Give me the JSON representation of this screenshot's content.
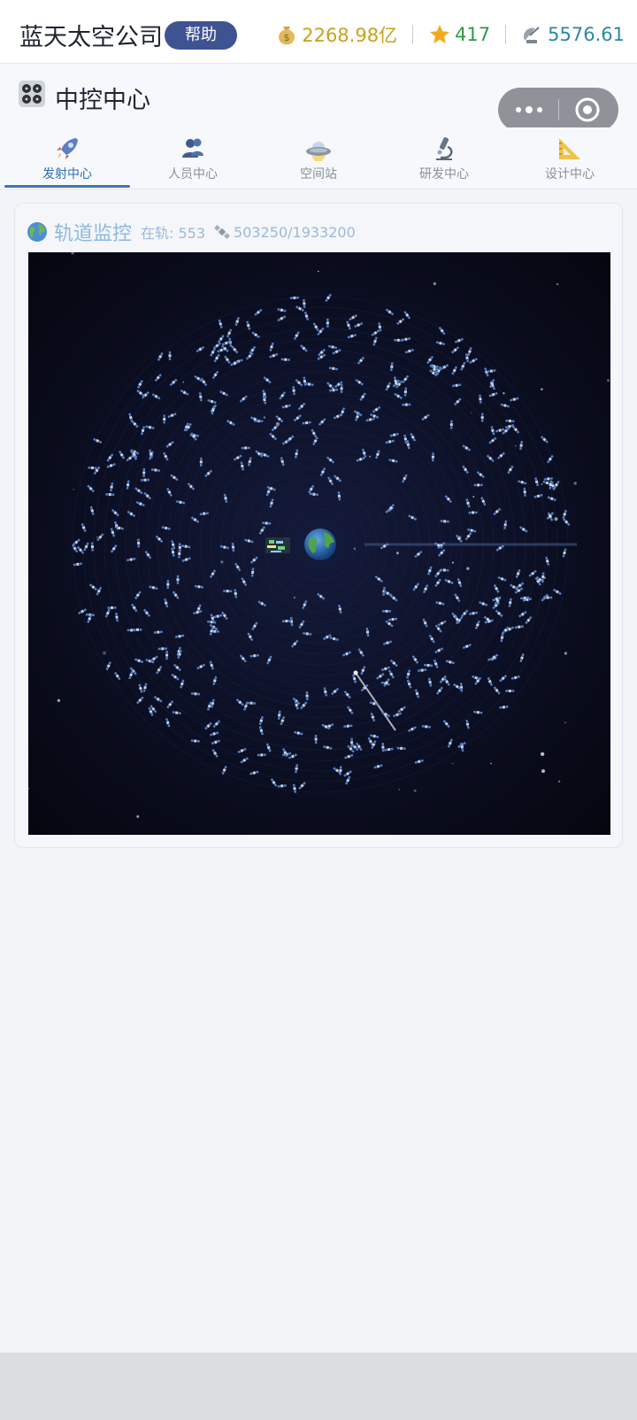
{
  "header": {
    "company_name": "蓝天太空公司",
    "help_label": "帮助",
    "stats": [
      {
        "icon": "money-bag-icon",
        "value": "2268.98亿",
        "color": "#c7a21c"
      },
      {
        "icon": "star-icon",
        "value": "417",
        "color": "#2e9a44"
      },
      {
        "icon": "satellite-dish-icon",
        "value": "5576.61",
        "color": "#2a86a8"
      }
    ]
  },
  "subhead": {
    "icon": "control-knobs-icon",
    "title": "中控中心"
  },
  "tabs": [
    {
      "label": "发射中心",
      "icon": "rocket-icon",
      "active": true
    },
    {
      "label": "人员中心",
      "icon": "people-icon",
      "active": false
    },
    {
      "label": "空间站",
      "icon": "ufo-icon",
      "active": false
    },
    {
      "label": "研发中心",
      "icon": "microscope-icon",
      "active": false
    },
    {
      "label": "设计中心",
      "icon": "triangle-ruler-icon",
      "active": false
    }
  ],
  "orbit_card": {
    "icon": "globe-icon",
    "title": "轨道监控",
    "in_orbit_label": "在轨: 553",
    "capacity_text": "503250/1933200"
  },
  "colors": {
    "accent": "#3d77b6",
    "space_bg": "#0a0d1f",
    "help_bg": "#3e5391"
  }
}
